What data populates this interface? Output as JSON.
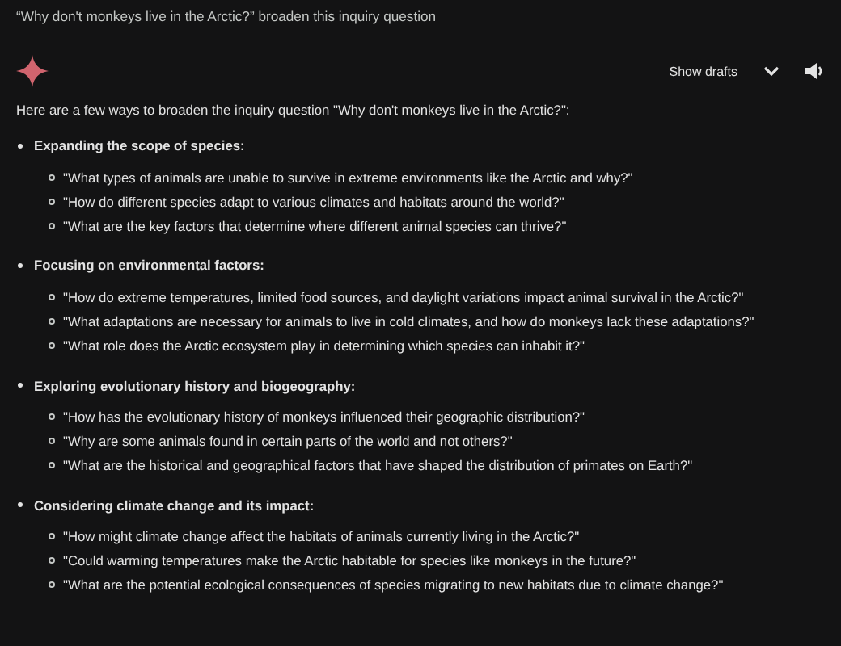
{
  "prompt": "“Why don't monkeys live in the Arctic?” broaden this inquiry question",
  "header": {
    "show_drafts": "Show drafts"
  },
  "intro": "Here are a few ways to broaden the inquiry question \"Why don't monkeys live in the Arctic?\":",
  "sections": [
    {
      "heading": "Expanding the scope of species:",
      "items": [
        "\"What types of animals are unable to survive in extreme environments like the Arctic and why?\"",
        "\"How do different species adapt to various climates and habitats around the world?\"",
        "\"What are the key factors that determine where different animal species can thrive?\""
      ]
    },
    {
      "heading": "Focusing on environmental factors:",
      "items": [
        "\"How do extreme temperatures, limited food sources, and daylight variations impact animal survival in the Arctic?\"",
        "\"What adaptations are necessary for animals to live in cold climates, and how do monkeys lack these adaptations?\"",
        "\"What role does the Arctic ecosystem play in determining which species can inhabit it?\""
      ]
    },
    {
      "heading": "Exploring evolutionary history and biogeography:",
      "items": [
        "\"How has the evolutionary history of monkeys influenced their geographic distribution?\"",
        "\"Why are some animals found in certain parts of the world and not others?\"",
        "\"What are the historical and geographical factors that have shaped the distribution of primates on Earth?\""
      ]
    },
    {
      "heading": "Considering climate change and its impact:",
      "items": [
        "\"How might climate change affect the habitats of animals currently living in the Arctic?\"",
        "\"Could warming temperatures make the Arctic habitable for species like monkeys in the future?\"",
        "\"What are the potential ecological consequences of species migrating to new habitats due to climate change?\""
      ]
    }
  ]
}
